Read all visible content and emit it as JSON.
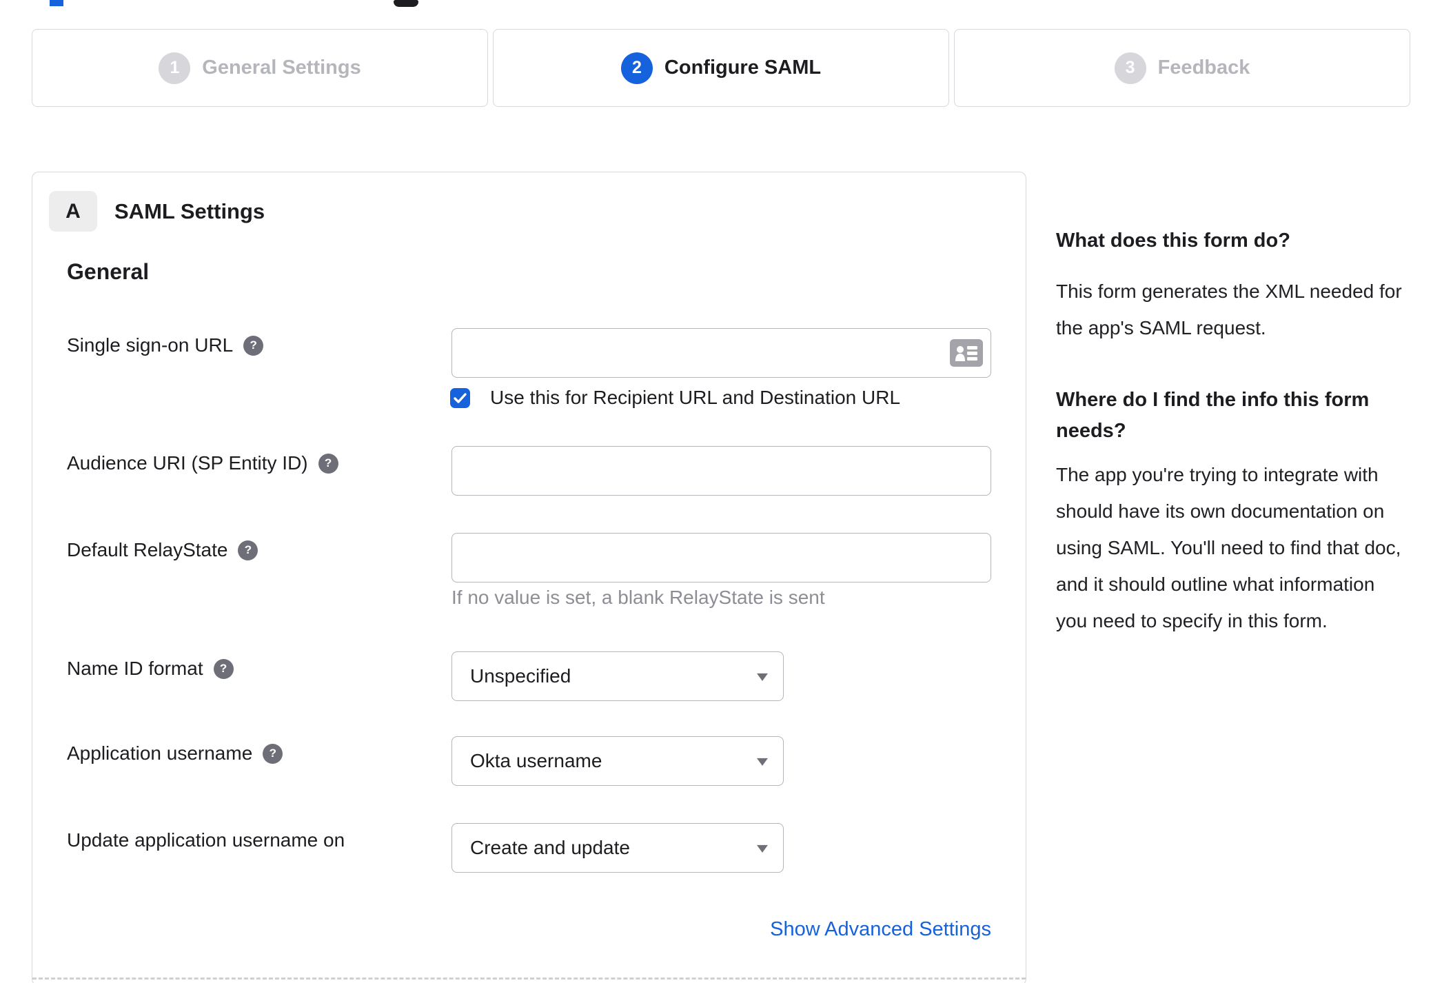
{
  "stepper": {
    "steps": [
      {
        "number": "1",
        "label": "General Settings",
        "state": "inactive"
      },
      {
        "number": "2",
        "label": "Configure SAML",
        "state": "active"
      },
      {
        "number": "3",
        "label": "Feedback",
        "state": "inactive"
      }
    ]
  },
  "saml_card": {
    "section_badge": "A",
    "section_title": "SAML Settings",
    "group_heading": "General",
    "sso_url": {
      "label": "Single sign-on URL",
      "value": "",
      "checkbox_label": "Use this for Recipient URL and Destination URL",
      "checkbox_checked": true
    },
    "audience_uri": {
      "label": "Audience URI (SP Entity ID)",
      "value": ""
    },
    "default_relay_state": {
      "label": "Default RelayState",
      "value": "",
      "helper": "If no value is set, a blank RelayState is sent"
    },
    "name_id_format": {
      "label": "Name ID format",
      "value": "Unspecified"
    },
    "application_username": {
      "label": "Application username",
      "value": "Okta username"
    },
    "update_application_username_on": {
      "label": "Update application username on",
      "value": "Create and update"
    },
    "advanced_link": "Show Advanced Settings"
  },
  "help_panel": {
    "q1_title": "What does this form do?",
    "q1_body": "This form generates the XML needed for the app's SAML request.",
    "q2_title": "Where do I find the info this form needs?",
    "q2_body": "The app you're trying to integrate with should have its own documentation on using SAML. You'll need to find that doc, and it should outline what information you need to specify in this form."
  },
  "icons": {
    "help": "question-mark",
    "variable_picker": "contact-card",
    "dropdown_caret": "triangle-down",
    "checkbox_check": "checkmark"
  },
  "colors": {
    "accent_blue": "#1662dd",
    "text_dark": "#1d1d21",
    "text_grey": "#8d8d95",
    "inactive_grey": "#d6d6db",
    "border_grey": "#d8d8dc"
  }
}
